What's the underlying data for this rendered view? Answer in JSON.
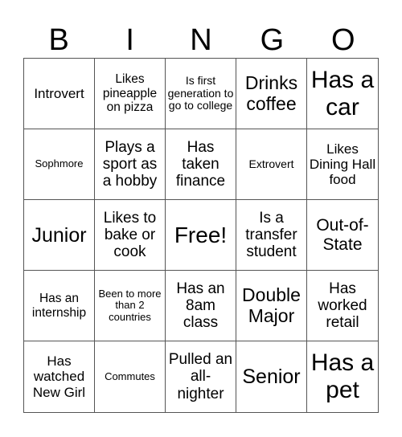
{
  "header": [
    "B",
    "I",
    "N",
    "G",
    "O"
  ],
  "cells": [
    {
      "text": "Introvert",
      "size": "s16"
    },
    {
      "text": "Likes pineapple on pizza",
      "size": "s15"
    },
    {
      "text": "Is first generation to go to college",
      "size": "s14"
    },
    {
      "text": "Drinks coffee",
      "size": "s22"
    },
    {
      "text": "Has a car",
      "size": "s28"
    },
    {
      "text": "Sophmore",
      "size": "s13"
    },
    {
      "text": "Plays a sport as a hobby",
      "size": "s18"
    },
    {
      "text": "Has taken finance",
      "size": "s18"
    },
    {
      "text": "Extrovert",
      "size": "s14"
    },
    {
      "text": "Likes Dining Hall food",
      "size": "s16"
    },
    {
      "text": "Junior",
      "size": "s24"
    },
    {
      "text": "Likes to bake or cook",
      "size": "s18"
    },
    {
      "text": "Free!",
      "size": "s26"
    },
    {
      "text": "Is a transfer student",
      "size": "s18"
    },
    {
      "text": "Out-of-State",
      "size": "s20"
    },
    {
      "text": "Has an internship",
      "size": "s15"
    },
    {
      "text": "Been to more than 2 countries",
      "size": "s13"
    },
    {
      "text": "Has an 8am class",
      "size": "s18"
    },
    {
      "text": "Double Major",
      "size": "s22"
    },
    {
      "text": "Has worked retail",
      "size": "s18"
    },
    {
      "text": "Has watched New Girl",
      "size": "s16"
    },
    {
      "text": "Commutes",
      "size": "s13"
    },
    {
      "text": "Pulled an all-nighter",
      "size": "s18"
    },
    {
      "text": "Senior",
      "size": "s24"
    },
    {
      "text": "Has a pet",
      "size": "s28"
    }
  ]
}
